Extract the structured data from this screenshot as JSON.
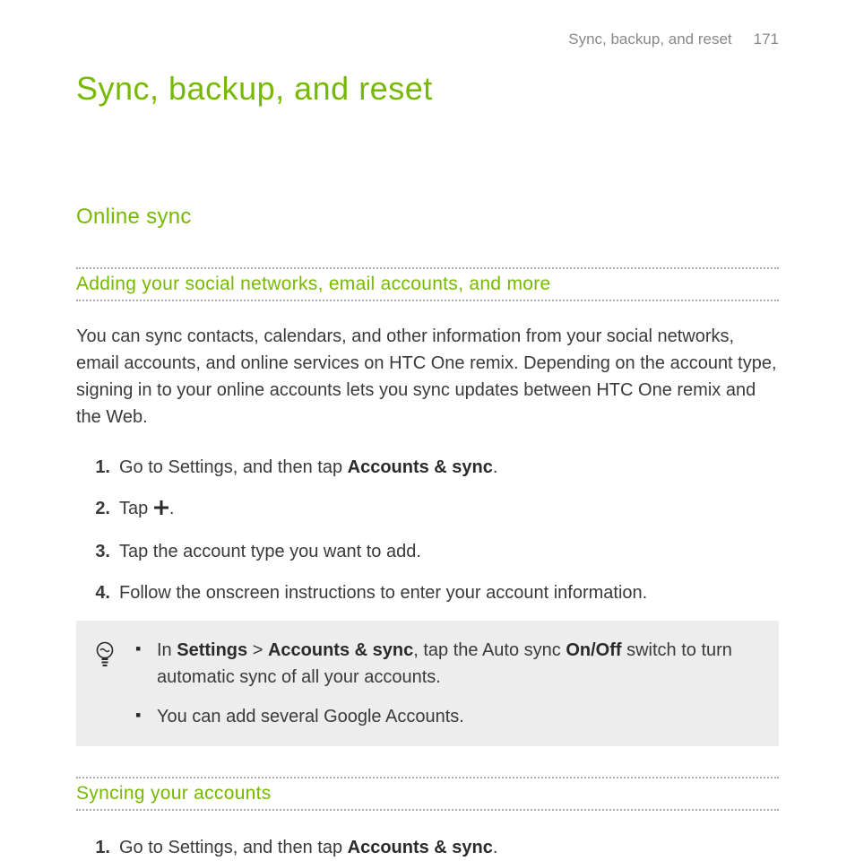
{
  "header": {
    "section": "Sync, backup, and reset",
    "page_number": "171"
  },
  "chapter_title": "Sync, backup, and reset",
  "h2_online_sync": "Online sync",
  "h3_adding": "Adding your social networks, email accounts, and more",
  "intro_para": "You can sync contacts, calendars, and other information from your social networks, email accounts, and online services on HTC One remix. Depending on the account type, signing in to your online accounts lets you sync updates between HTC One remix and the Web.",
  "steps": {
    "n1": "1.",
    "s1_a": "Go to Settings, and then tap ",
    "s1_b": "Accounts & sync",
    "s1_c": ".",
    "n2": "2.",
    "s2_a": "Tap ",
    "s2_b": ".",
    "n3": "3.",
    "s3": "Tap the account type you want to add.",
    "n4": "4.",
    "s4": "Follow the onscreen instructions to enter your account information."
  },
  "tips": {
    "t1_a": "In ",
    "t1_b": "Settings",
    "t1_c": " > ",
    "t1_d": "Accounts & sync",
    "t1_e": ", tap the Auto sync ",
    "t1_f": "On/Off",
    "t1_g": " switch to turn automatic sync of all your accounts.",
    "t2": "You can add several Google Accounts."
  },
  "h3_syncing": "Syncing your accounts",
  "steps2": {
    "n1": "1.",
    "s1_a": "Go to Settings, and then tap ",
    "s1_b": "Accounts & sync",
    "s1_c": "."
  }
}
